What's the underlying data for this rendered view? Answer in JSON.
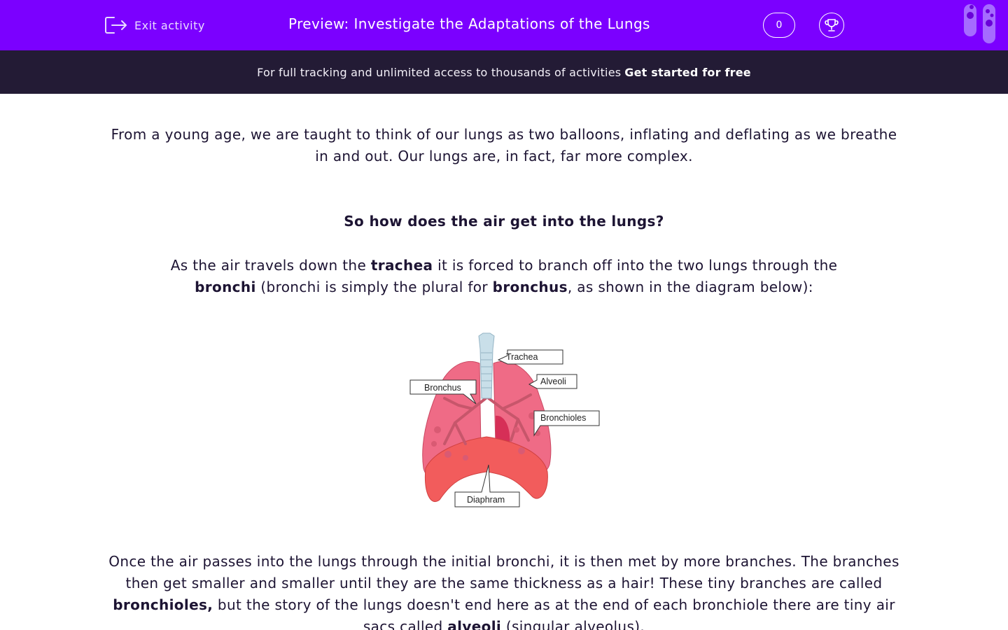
{
  "header": {
    "exit_label": "Exit activity",
    "title": "Preview: Investigate the Adaptations of the Lungs",
    "score": "0"
  },
  "banner": {
    "text": "For full tracking and unlimited access to thousands of activities",
    "link": "Get started for free"
  },
  "content": {
    "intro": "From a young age, we are taught to think of our lungs as two balloons, inflating and deflating as we breathe in and out. Our lungs are, in fact, far more complex.",
    "heading": "So how does the air get into the lungs?",
    "p2": {
      "a": "As the air travels down the ",
      "b": "trachea",
      "c": " it is forced to branch off into the two lungs through the ",
      "d": "bronchi",
      "e": " (bronchi is simply the plural for ",
      "f": "bronchus",
      "g": ", as shown in the diagram below):"
    },
    "p3": {
      "a": "Once the air passes into the lungs through the initial bronchi, it is then met by more branches. The branches then get smaller and smaller until they are the same thickness as a hair! These tiny branches are called ",
      "b": "bronchioles,",
      "c": " but the story of the lungs doesn't end here as at the end of each bronchiole there are tiny air sacs called ",
      "d": "alveoli",
      "e": " (singular alveolus)."
    }
  },
  "diagram": {
    "labels": {
      "trachea": "Trachea",
      "bronchus": "Bronchus",
      "alveoli": "Alveoli",
      "bronchioles": "Bronchioles",
      "diaphram": "Diaphram"
    }
  },
  "colors": {
    "brand": "#7b00ff",
    "banner": "#231b35",
    "text": "#1d1433"
  },
  "icons": [
    "exit-icon",
    "trophy-icon",
    "test-tubes-icon"
  ]
}
